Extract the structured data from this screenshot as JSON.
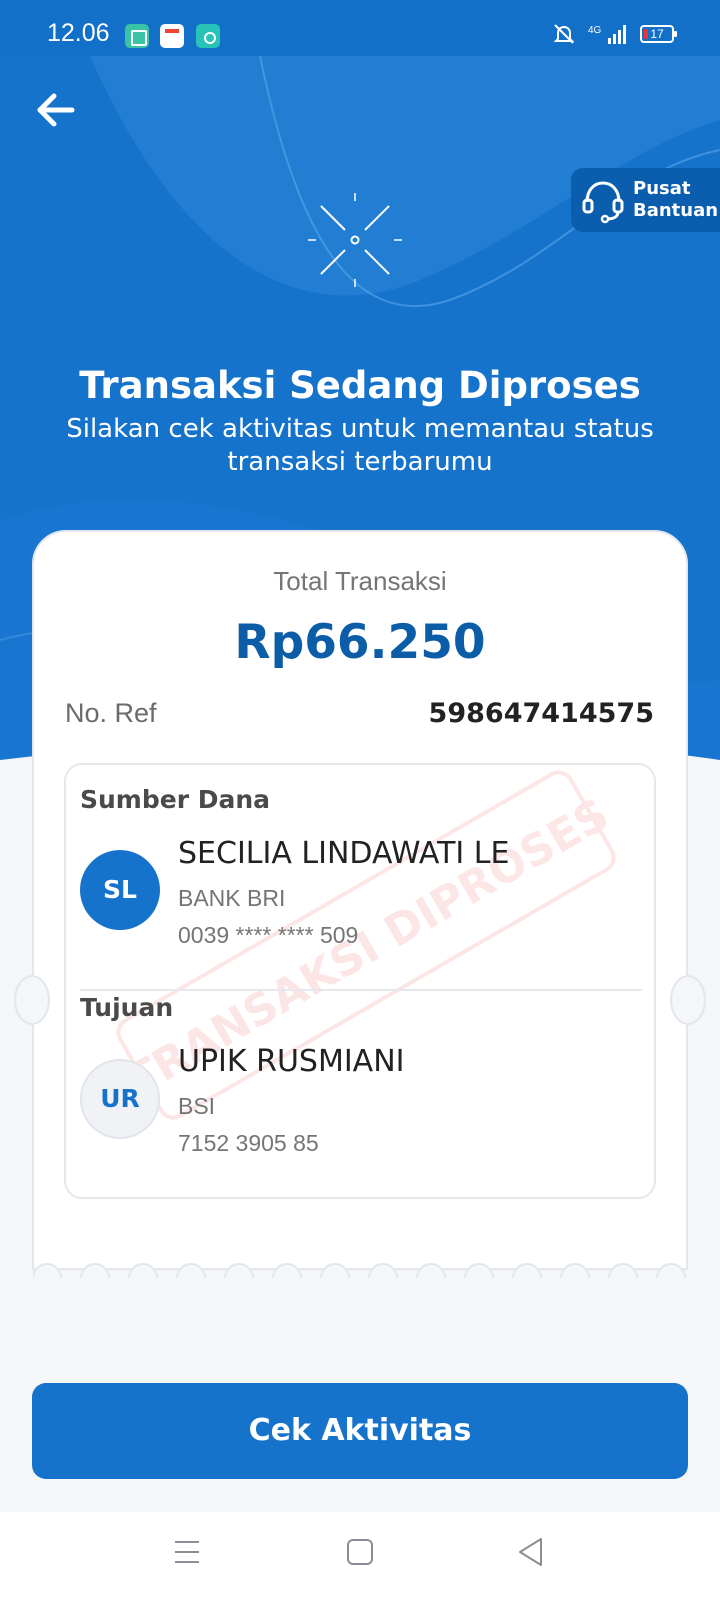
{
  "status_bar": {
    "time": "12.06",
    "network": "4G",
    "battery": "17",
    "icons": [
      "app-notification-icon",
      "pdf-notification-icon",
      "app-notification-icon",
      "bell-muted-icon",
      "signal-icon",
      "battery-icon"
    ]
  },
  "header": {
    "back_icon": "arrow-left-icon",
    "help_label": "Pusat Bantuan",
    "help_icon": "headset-icon",
    "status_icon": "loading-spinner-icon",
    "title": "Transaksi Sedang Diproses",
    "subtitle": "Silakan cek aktivitas untuk memantau status transaksi terbarumu"
  },
  "receipt": {
    "total_label": "Total Transaksi",
    "amount": "Rp66.250",
    "ref_label": "No. Ref",
    "ref_value": "598647414575",
    "stamp_text": "TRANSAKSI DIPROSES",
    "source": {
      "label": "Sumber Dana",
      "initials": "SL",
      "name": "SECILIA LINDAWATI LE",
      "bank": "BANK BRI",
      "account": "0039 **** **** 509"
    },
    "destination": {
      "label": "Tujuan",
      "initials": "UR",
      "name": "UPIK RUSMIANI",
      "bank": "BSI",
      "account": "7152 3905 85"
    }
  },
  "actions": {
    "primary": "Cek Aktivitas"
  },
  "nav": {
    "icons": [
      "menu-icon",
      "home-square-icon",
      "back-triangle-icon"
    ]
  },
  "colors": {
    "primary": "#1673cc",
    "amount": "#0b5da8",
    "stamp": "#e53935"
  }
}
